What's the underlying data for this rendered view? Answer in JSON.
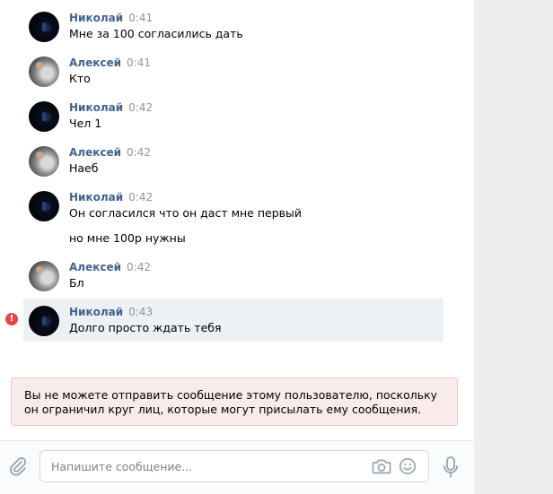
{
  "messages": [
    {
      "author": "Николай",
      "time": "0:41",
      "lines": [
        "Мне за 100 согласились дать"
      ]
    },
    {
      "author": "Алексей",
      "time": "0:41",
      "lines": [
        "Кто"
      ]
    },
    {
      "author": "Николай",
      "time": "0:42",
      "lines": [
        "Чел 1"
      ]
    },
    {
      "author": "Алексей",
      "time": "0:42",
      "lines": [
        "Наеб"
      ]
    },
    {
      "author": "Николай",
      "time": "0:42",
      "lines": [
        "Он согласился что он даст мне первый",
        "но мне 100р нужны"
      ]
    },
    {
      "author": "Алексей",
      "time": "0:42",
      "lines": [
        "Бл"
      ]
    },
    {
      "author": "Николай",
      "time": "0:43",
      "lines": [
        "Долго просто ждать тебя"
      ],
      "failed": true
    }
  ],
  "notice": {
    "text": "Вы не можете отправить сообщение этому пользователю, поскольку он ограничил круг лиц, которые могут присылать ему сообщения."
  },
  "composer": {
    "placeholder": "Напишите сообщение..."
  },
  "icons": {
    "error": "!",
    "attach": "paperclip-icon",
    "camera": "camera-icon",
    "emoji": "smile-icon",
    "voice": "microphone-icon"
  },
  "colors": {
    "author": "#42648b",
    "time": "#939393",
    "highlight": "#edf0f5",
    "error": "#e64646",
    "notice_bg": "#faebeb",
    "notice_border": "#ebc7c9",
    "icon": "#99a2ad"
  }
}
